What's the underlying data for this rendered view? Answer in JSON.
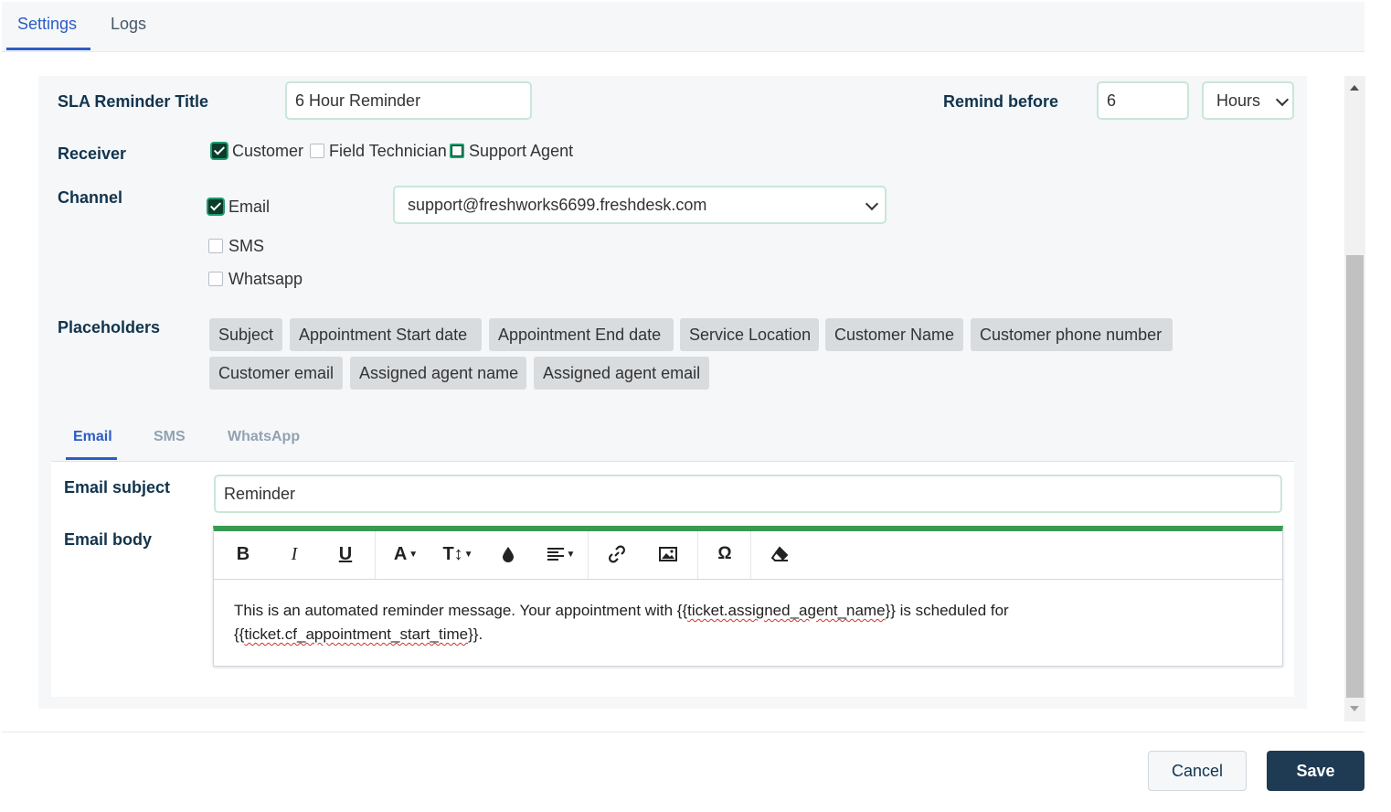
{
  "top_tabs": [
    {
      "label": "Settings",
      "active": true
    },
    {
      "label": "Logs",
      "active": false
    }
  ],
  "form": {
    "title_label": "SLA Reminder Title",
    "title_value": "6 Hour Reminder",
    "remind_before_label": "Remind before",
    "remind_before_value": "6",
    "remind_unit_selected": "Hours",
    "receiver_label": "Receiver",
    "receivers": [
      {
        "label": "Customer",
        "checked": true
      },
      {
        "label": "Field Technician",
        "checked": false
      },
      {
        "label": "Support Agent",
        "checked": false
      }
    ],
    "channel_label": "Channel",
    "channels": [
      {
        "label": "Email",
        "checked": true
      },
      {
        "label": "SMS",
        "checked": false
      },
      {
        "label": "Whatsapp",
        "checked": false
      }
    ],
    "email_from_selected": "support@freshworks6699.freshdesk.com",
    "placeholders_label": "Placeholders",
    "placeholders": [
      "Subject",
      "Appointment Start date",
      "Appointment End date",
      "Service Location",
      "Customer Name",
      "Customer phone number",
      "Customer email",
      "Assigned agent name",
      "Assigned agent email"
    ]
  },
  "message_tabs": [
    {
      "label": "Email",
      "active": true
    },
    {
      "label": "SMS",
      "active": false
    },
    {
      "label": "WhatsApp",
      "active": false
    }
  ],
  "email": {
    "subject_label": "Email subject",
    "subject_value": "Reminder",
    "body_label": "Email body",
    "body_line1_prefix": "This is an automated reminder message. Your appointment with {{",
    "body_line1_token": "ticket.assigned_agent_name",
    "body_line1_suffix": "}} is scheduled for",
    "body_line2_prefix": "{{",
    "body_line2_token": "ticket.cf_appointment_start_time",
    "body_line2_suffix": "}}."
  },
  "toolbar_icons": [
    "bold-icon",
    "italic-icon",
    "underline-icon",
    "font-color-icon",
    "font-size-icon",
    "background-color-icon",
    "align-icon",
    "link-icon",
    "image-icon",
    "special-char-icon",
    "clear-format-icon"
  ],
  "footer": {
    "cancel_label": "Cancel",
    "save_label": "Save"
  },
  "colors": {
    "accent": "#2c5cc5",
    "save_button": "#1e3b53",
    "editor_top_bar": "#3a9a51"
  }
}
